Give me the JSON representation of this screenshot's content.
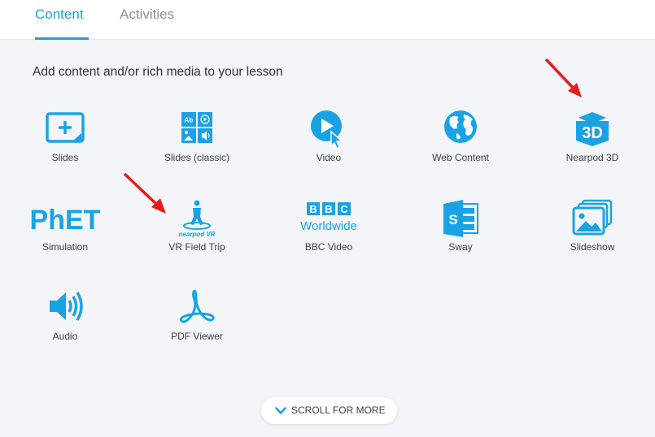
{
  "tabs": [
    {
      "label": "Content",
      "active": true
    },
    {
      "label": "Activities",
      "active": false
    }
  ],
  "heading": "Add content and/or rich media to your lesson",
  "accent_color": "#19a3e6",
  "arrow_color": "#e51c1c",
  "tiles": [
    {
      "label": "Slides",
      "icon": "slides-add-icon"
    },
    {
      "label": "Slides (classic)",
      "icon": "slides-classic-icon"
    },
    {
      "label": "Video",
      "icon": "video-play-icon"
    },
    {
      "label": "Web Content",
      "icon": "globe-icon"
    },
    {
      "label": "Nearpod 3D",
      "icon": "cube-3d-icon"
    },
    {
      "label": "Simulation",
      "icon": "phet-logo-icon",
      "logo_text": "PhET"
    },
    {
      "label": "VR Field Trip",
      "icon": "vr-field-trip-icon",
      "logo_text": "nearpod VR"
    },
    {
      "label": "BBC Video",
      "icon": "bbc-worldwide-logo-icon",
      "logo_text": "BBC Worldwide"
    },
    {
      "label": "Sway",
      "icon": "sway-icon"
    },
    {
      "label": "Slideshow",
      "icon": "slideshow-images-icon"
    },
    {
      "label": "Audio",
      "icon": "speaker-icon"
    },
    {
      "label": "PDF Viewer",
      "icon": "pdf-icon"
    }
  ],
  "scroll_button": {
    "label": "SCROLL FOR MORE",
    "icon": "chevron-down-icon"
  }
}
